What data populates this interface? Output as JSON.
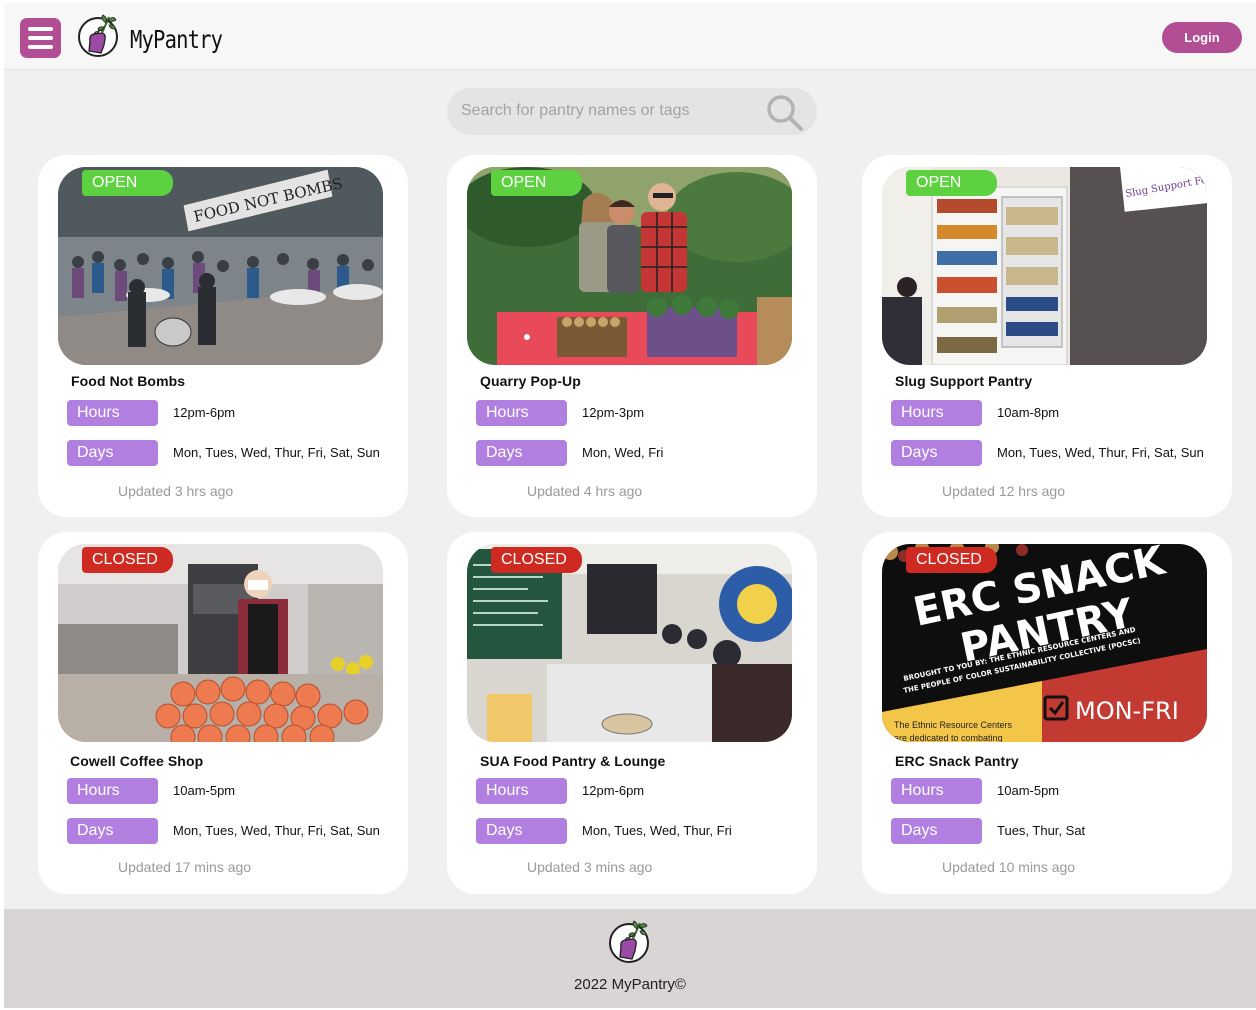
{
  "app": {
    "brand": "MyPantry",
    "login_label": "Login"
  },
  "search": {
    "placeholder": "Search for pantry names or tags"
  },
  "labels": {
    "hours": "Hours",
    "days": "Days"
  },
  "status_colors": {
    "open": "#5dd140",
    "closed": "#cf2a22",
    "accent": "#b24f94",
    "pill": "#b17fe0"
  },
  "pantries": [
    {
      "name": "Food Not Bombs",
      "status": "OPEN",
      "hours": "12pm-6pm",
      "days": "Mon, Tues, Wed, Thur, Fri, Sat, Sun",
      "updated": "Updated 3 hrs ago",
      "image_text": "FOOD NOT BOMBS"
    },
    {
      "name": "Quarry Pop-Up",
      "status": "OPEN",
      "hours": "12pm-3pm",
      "days": "Mon, Wed,  Fri",
      "updated": "Updated 4 hrs ago"
    },
    {
      "name": "Slug Support Pantry",
      "status": "OPEN",
      "hours": "10am-8pm",
      "days": "Mon, Tues, Wed, Thur, Fri, Sat, Sun",
      "updated": "Updated 12 hrs ago",
      "image_text": "Slug Support Food Pantry!"
    },
    {
      "name": "Cowell Coffee Shop",
      "status": "CLOSED",
      "hours": "10am-5pm",
      "days": "Mon, Tues, Wed, Thur, Fri, Sat, Sun",
      "updated": "Updated 17 mins ago"
    },
    {
      "name": "SUA Food Pantry & Lounge",
      "status": "CLOSED",
      "hours": "12pm-6pm",
      "days": "Mon, Tues, Wed, Thur, Fri",
      "updated": "Updated 3 mins ago"
    },
    {
      "name": "ERC Snack Pantry",
      "status": "CLOSED",
      "hours": "10am-5pm",
      "days": "Tues, Thur, Sat",
      "updated": "Updated 10 mins ago",
      "poster": {
        "line1": "ERC SNACK",
        "line2": "PANTRY",
        "tagline1": "BROUGHT TO YOU BY: THE ETHNIC RESOURCE CENTERS AND",
        "tagline2": "THE PEOPLE OF COLOR SUSTAINABILITY COLLECTIVE (POCSC)",
        "days": "MON-FRI",
        "blurb1": "The Ethnic Resource Centers",
        "blurb2": "are dedicated to combating"
      }
    }
  ],
  "footer": {
    "copyright": "2022 MyPantry©"
  }
}
